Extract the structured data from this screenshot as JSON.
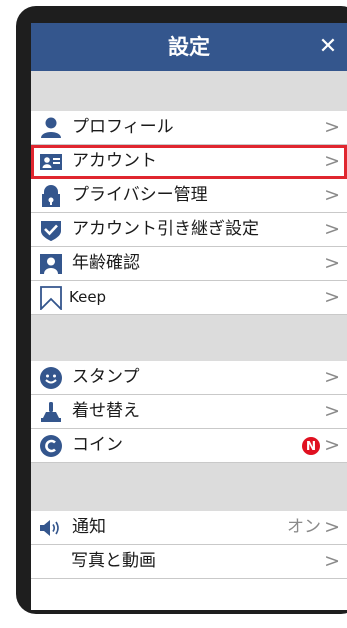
{
  "header": {
    "title": "設定",
    "close_label": "✕"
  },
  "menu": {
    "chevron": ">",
    "items": [
      {
        "label": "プロフィール",
        "icon": "person-icon"
      },
      {
        "label": "アカウント",
        "icon": "id-card-icon",
        "highlighted": true
      },
      {
        "label": "プライバシー管理",
        "icon": "lock-icon"
      },
      {
        "label": "アカウント引き継ぎ設定",
        "icon": "checkmark-shield-icon"
      },
      {
        "label": "年齢確認",
        "icon": "portrait-icon"
      },
      {
        "label": "Keep",
        "icon": "bookmark-icon"
      },
      {
        "label": "スタンプ",
        "icon": "smiley-icon"
      },
      {
        "label": "着せ替え",
        "icon": "brush-icon"
      },
      {
        "label": "コイン",
        "icon": "coin-icon",
        "badge": "N"
      },
      {
        "label": "通知",
        "icon": "speaker-icon",
        "status": "オン"
      },
      {
        "label": "写真と動画",
        "icon": ""
      }
    ]
  },
  "colors": {
    "header_bg": "#34568d",
    "icon": "#34568d",
    "highlight_border": "#e0262f",
    "badge_bg": "#e01020",
    "section_gap": "#dcdcdc"
  }
}
